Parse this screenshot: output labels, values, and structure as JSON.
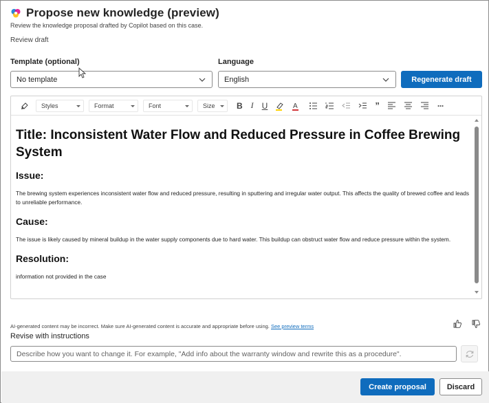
{
  "header": {
    "title": "Propose new knowledge (preview)",
    "subtitle": "Review the knowledge proposal drafted by Copilot based on this case.",
    "review_draft": "Review draft"
  },
  "template": {
    "label": "Template (optional)",
    "value": "No template"
  },
  "language": {
    "label": "Language",
    "value": "English"
  },
  "regenerate_label": "Regenerate draft",
  "toolbar": {
    "styles": "Styles",
    "format": "Format",
    "font": "Font",
    "size": "Size",
    "bold": "B",
    "italic": "I",
    "underline": "U",
    "quote": "”",
    "more": "···"
  },
  "document": {
    "title": "Title: Inconsistent Water Flow and Reduced Pressure in Coffee Brewing System",
    "issue_heading": "Issue:",
    "issue_text": "The brewing system experiences inconsistent water flow and reduced pressure, resulting in sputtering and irregular water output. This affects the quality of brewed coffee and leads to unreliable performance.",
    "cause_heading": "Cause:",
    "cause_text": "The issue is likely caused by mineral buildup in the water supply components due to hard water. This buildup can obstruct water flow and reduce pressure within the system.",
    "resolution_heading": "Resolution:",
    "resolution_text": "information not provided in the case"
  },
  "disclaimer": {
    "text": "AI-generated content may be incorrect. Make sure AI-generated content is accurate and appropriate before using. ",
    "link": "See preview terms"
  },
  "revise": {
    "label": "Revise with instructions",
    "placeholder": "Describe how you want to change it. For example, \"Add info about the warranty window and rewrite this as a procedure\"."
  },
  "footer": {
    "create_label": "Create proposal",
    "discard_label": "Discard"
  },
  "colors": {
    "accent": "#0f6cbd"
  }
}
